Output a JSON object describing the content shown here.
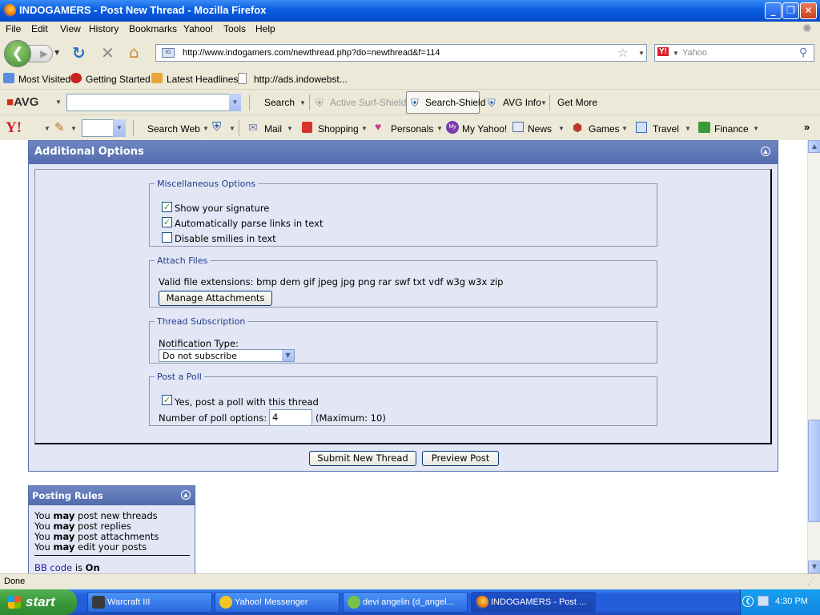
{
  "window": {
    "title": "INDOGAMERS - Post New Thread - Mozilla Firefox"
  },
  "menu": [
    "File",
    "Edit",
    "View",
    "History",
    "Bookmarks",
    "Yahoo!",
    "Tools",
    "Help"
  ],
  "nav": {
    "url": "http://www.indogamers.com/newthread.php?do=newthread&f=114",
    "search_placeholder": "Yahoo"
  },
  "bookmarks": [
    "Most Visited",
    "Getting Started",
    "Latest Headlines",
    "http://ads.indowebst..."
  ],
  "avg_toolbar": {
    "brand": "AVG",
    "search": "Search",
    "active_surf": "Active Surf-Shield",
    "search_shield": "Search-Shield",
    "avg_info": "AVG Info",
    "get_more": "Get More"
  },
  "yahoo_toolbar": {
    "search_web": "Search Web",
    "mail": "Mail",
    "shopping": "Shopping",
    "personals": "Personals",
    "my_yahoo": "My Yahoo!",
    "news": "News",
    "games": "Games",
    "travel": "Travel",
    "finance": "Finance"
  },
  "additional_options": {
    "title": "Additional Options",
    "misc": {
      "legend": "Miscellaneous Options",
      "options": [
        {
          "label": "Show your signature",
          "checked": true
        },
        {
          "label": "Automatically parse links in text",
          "checked": true
        },
        {
          "label": "Disable smilies in text",
          "checked": false
        }
      ]
    },
    "attach": {
      "legend": "Attach Files",
      "extensions": "Valid file extensions: bmp dem gif jpeg jpg png rar swf txt vdf w3g w3x zip",
      "button": "Manage Attachments"
    },
    "subscription": {
      "legend": "Thread Subscription",
      "label": "Notification Type:",
      "selected": "Do not subscribe"
    },
    "poll": {
      "legend": "Post a Poll",
      "checkbox_label": "Yes, post a poll with this thread",
      "checked": true,
      "count_label": "Number of poll options:",
      "count_value": "4",
      "max_text": "(Maximum: 10)"
    },
    "submit_button": "Submit New Thread",
    "preview_button": "Preview Post"
  },
  "posting_rules": {
    "title": "Posting Rules",
    "rules": [
      {
        "pre": "You",
        "bold": "may",
        "post": "post new threads"
      },
      {
        "pre": "You",
        "bold": "may",
        "post": "post replies"
      },
      {
        "pre": "You",
        "bold": "may",
        "post": "post attachments"
      },
      {
        "pre": "You",
        "bold": "may",
        "post": "edit your posts"
      }
    ],
    "bbcode_link": "BB code",
    "bbcode_is": "is",
    "bbcode_state": "On"
  },
  "status": "Done",
  "taskbar": {
    "start": "start",
    "tasks": [
      "Warcraft III",
      "Yahoo! Messenger",
      "devi angelin (d_angel...",
      "INDOGAMERS - Post ..."
    ],
    "clock": "4:30 PM"
  }
}
